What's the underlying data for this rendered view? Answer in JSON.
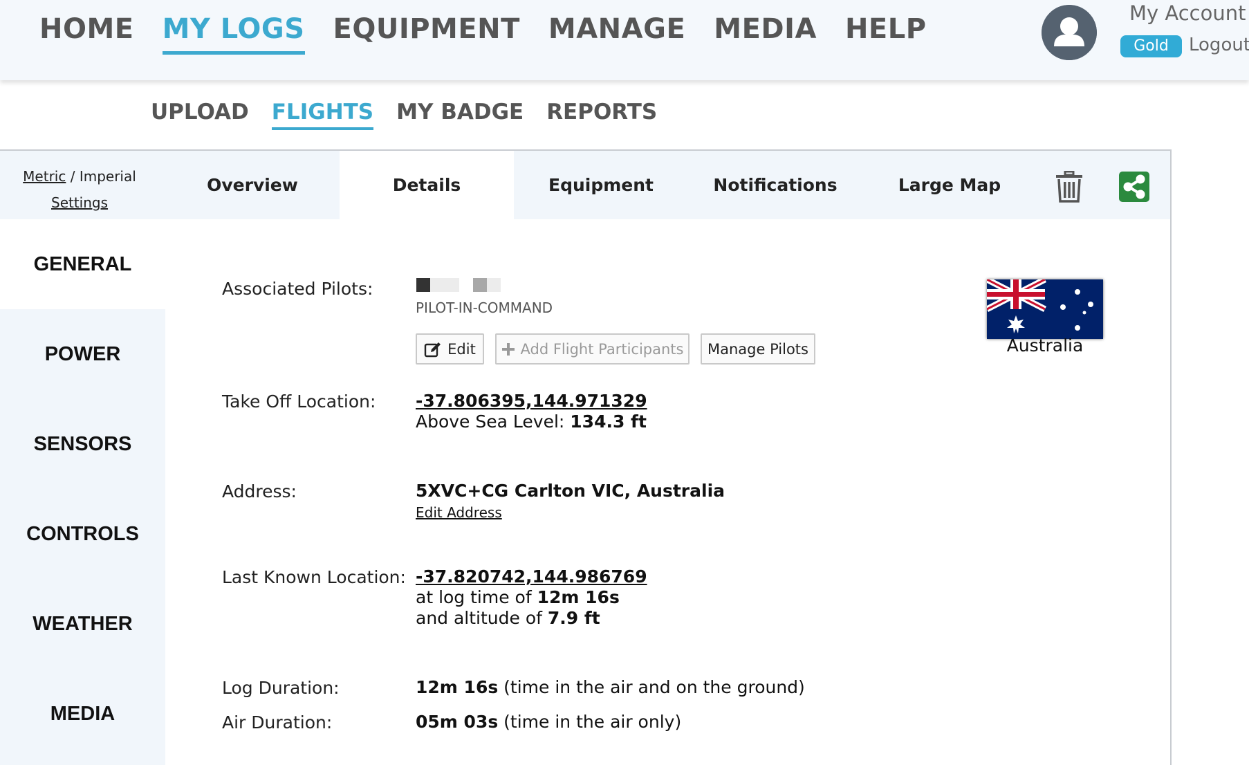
{
  "main_nav": [
    {
      "label": "HOME",
      "active": false
    },
    {
      "label": "MY LOGS",
      "active": true
    },
    {
      "label": "EQUIPMENT",
      "active": false
    },
    {
      "label": "MANAGE",
      "active": false
    },
    {
      "label": "MEDIA",
      "active": false
    },
    {
      "label": "HELP",
      "active": false
    }
  ],
  "account": {
    "my_account": "My Account",
    "badge": "Gold",
    "logout": "Logout"
  },
  "sub_nav": [
    {
      "label": "UPLOAD",
      "active": false
    },
    {
      "label": "FLIGHTS",
      "active": true
    },
    {
      "label": "MY BADGE",
      "active": false
    },
    {
      "label": "REPORTS",
      "active": false
    }
  ],
  "units": {
    "metric": "Metric",
    "separator": "/",
    "imperial": "Imperial",
    "settings": "Settings"
  },
  "tabs": [
    {
      "label": "Overview",
      "active": false
    },
    {
      "label": "Details",
      "active": true
    },
    {
      "label": "Equipment",
      "active": false
    },
    {
      "label": "Notifications",
      "active": false
    },
    {
      "label": "Large Map",
      "active": false
    }
  ],
  "side_menu": [
    {
      "label": "GENERAL",
      "active": true
    },
    {
      "label": "POWER",
      "active": false
    },
    {
      "label": "SENSORS",
      "active": false
    },
    {
      "label": "CONTROLS",
      "active": false
    },
    {
      "label": "WEATHER",
      "active": false
    },
    {
      "label": "MEDIA",
      "active": false
    }
  ],
  "details": {
    "pilots_label": "Associated Pilots:",
    "pilot_role": "PILOT-IN-COMMAND",
    "edit_button": "Edit",
    "add_participants_button": "Add Flight Participants",
    "manage_pilots_button": "Manage Pilots",
    "takeoff_label": "Take Off Location:",
    "takeoff_coords": "-37.806395,144.971329",
    "asl_prefix": "Above Sea Level:",
    "asl_value": "134.3 ft",
    "address_label": "Address:",
    "address_value": "5XVC+CG Carlton VIC, Australia",
    "edit_address": "Edit Address",
    "last_location_label": "Last Known Location:",
    "last_location_coords": "-37.820742,144.986769",
    "log_time_prefix": "at log time of",
    "log_time_value": "12m 16s",
    "altitude_prefix": "and altitude of",
    "altitude_value": "7.9 ft",
    "log_duration_label": "Log Duration:",
    "log_duration_value": "12m 16s",
    "log_duration_note": "(time in the air and on the ground)",
    "air_duration_label": "Air Duration:",
    "air_duration_value": "05m 03s",
    "air_duration_note": "(time in the air only)",
    "country": "Australia"
  },
  "colors": {
    "accent": "#3ca9cf",
    "gold_badge": "#31abd6",
    "share_green": "#2b8a3e",
    "flag_blue": "#012169"
  }
}
